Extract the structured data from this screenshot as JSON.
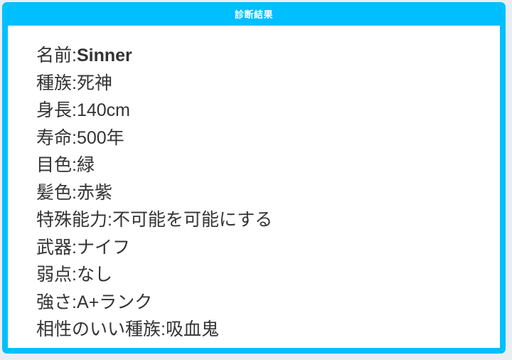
{
  "panel": {
    "title": "診断結果"
  },
  "results": [
    {
      "label": "名前",
      "sep": ":",
      "value": "Sinner",
      "bold": true
    },
    {
      "label": "種族",
      "sep": ":",
      "value": "死神",
      "bold": false
    },
    {
      "label": "身長",
      "sep": ":",
      "value": "140cm",
      "bold": false
    },
    {
      "label": "寿命",
      "sep": ":",
      "value": "500年",
      "bold": false
    },
    {
      "label": "目色",
      "sep": ":",
      "value": "緑",
      "bold": false
    },
    {
      "label": "髪色",
      "sep": ":",
      "value": "赤紫",
      "bold": false
    },
    {
      "label": "特殊能力",
      "sep": ":",
      "value": "不可能を可能にする",
      "bold": false
    },
    {
      "label": "武器",
      "sep": ":",
      "value": "ナイフ",
      "bold": false
    },
    {
      "label": "弱点",
      "sep": ":",
      "value": "なし",
      "bold": false
    },
    {
      "label": "強さ",
      "sep": ":",
      "value": "A+ランク",
      "bold": false
    },
    {
      "label": "相性のいい種族",
      "sep": ":",
      "value": "吸血鬼",
      "bold": false
    }
  ],
  "colors": {
    "frame": "#00bfff",
    "panel_background": "#ffffff",
    "text": "#333333"
  }
}
